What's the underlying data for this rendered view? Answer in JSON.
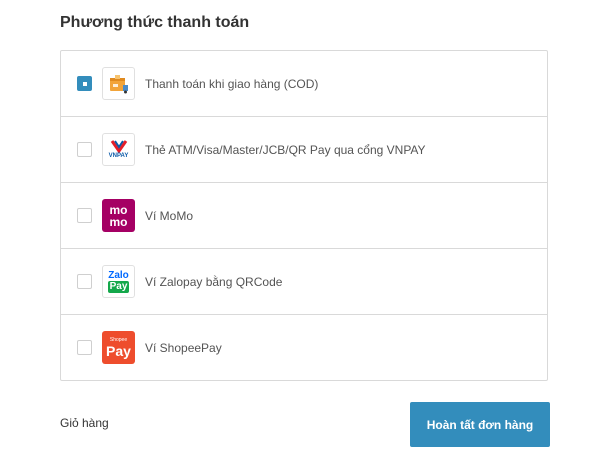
{
  "section_title": "Phương thức thanh toán",
  "methods": [
    {
      "label": "Thanh toán khi giao hàng (COD)",
      "selected": true,
      "icon": "cod-box-icon"
    },
    {
      "label": "Thẻ ATM/Visa/Master/JCB/QR Pay qua cổng VNPAY",
      "selected": false,
      "icon": "vnpay-logo",
      "logo_text": "VNPAY"
    },
    {
      "label": "Ví MoMo",
      "selected": false,
      "icon": "momo-logo",
      "logo_text_top": "mo",
      "logo_text_bottom": "mo"
    },
    {
      "label": "Ví Zalopay bằng QRCode",
      "selected": false,
      "icon": "zalopay-logo",
      "logo_text_top": "Zalo",
      "logo_text_bottom": "Pay"
    },
    {
      "label": "Ví ShopeePay",
      "selected": false,
      "icon": "shopeepay-logo",
      "logo_text_top": "Shopee",
      "logo_text_bottom": "Pay"
    }
  ],
  "footer": {
    "cart_link": "Giỏ hàng",
    "submit_label": "Hoàn tất đơn hàng"
  },
  "colors": {
    "accent": "#338dbc",
    "momo": "#a50064",
    "zalopay_green": "#14a84b",
    "zalopay_blue": "#0068ff",
    "shopeepay": "#ee4d2d",
    "vnpay_red": "#e31e2a",
    "vnpay_blue": "#0a5aa8",
    "cod_orange": "#f2a43a"
  }
}
